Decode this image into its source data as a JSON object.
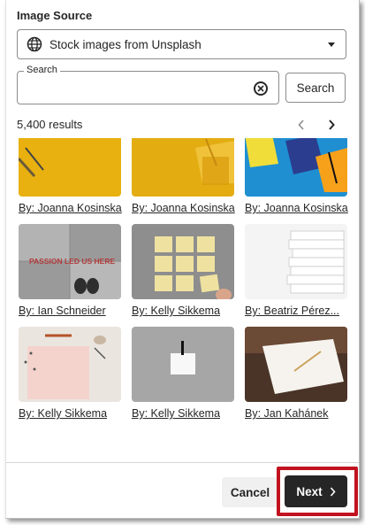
{
  "image_source": {
    "label": "Image Source",
    "selected": "Stock images from Unsplash"
  },
  "search": {
    "legend": "Search",
    "value": "",
    "button_label": "Search"
  },
  "results": {
    "count_text": "5,400 results"
  },
  "images": [
    {
      "credit": "By: Joanna Kosinska"
    },
    {
      "credit": "By: Joanna Kosinska"
    },
    {
      "credit": "By: Joanna Kosinska"
    },
    {
      "credit": "By: Ian Schneider",
      "overlay_text": "PASSION LED US HERE"
    },
    {
      "credit": "By: Kelly Sikkema"
    },
    {
      "credit": "By: Beatriz Pérez..."
    },
    {
      "credit": "By: Kelly Sikkema"
    },
    {
      "credit": "By: Kelly Sikkema"
    },
    {
      "credit": "By: Jan Kahánek"
    }
  ],
  "footer": {
    "cancel_label": "Cancel",
    "next_label": "Next"
  },
  "colors": {
    "next_button": "#262626",
    "highlight_box": "#c1121f"
  }
}
